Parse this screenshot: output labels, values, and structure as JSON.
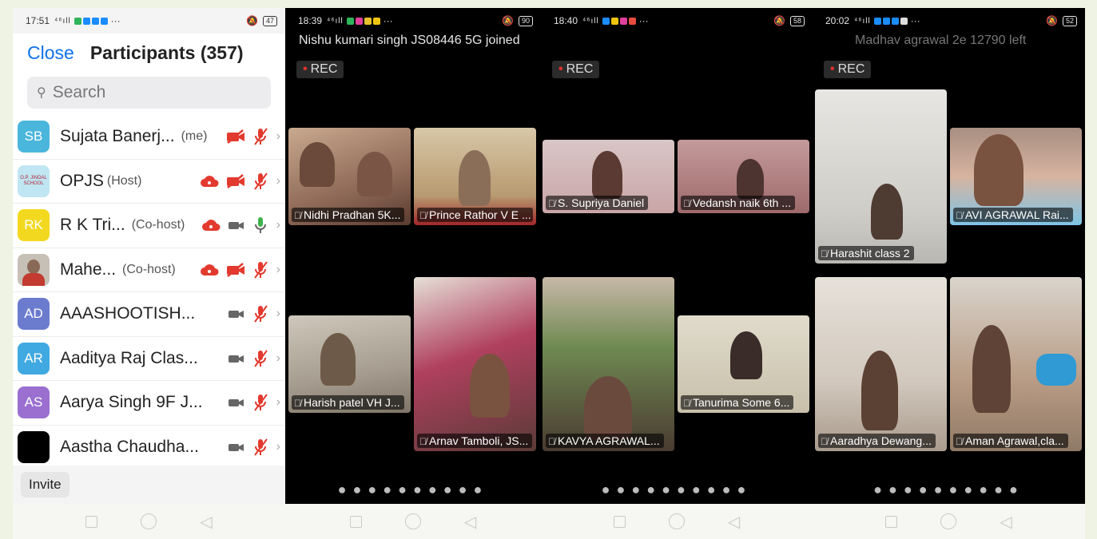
{
  "panel1": {
    "status": {
      "time": "17:51",
      "signal": "⁴⁶ıll",
      "battery": "47"
    },
    "close_label": "Close",
    "title": "Participants (357)",
    "search_placeholder": "Search",
    "participants": [
      {
        "initials": "SB",
        "avatar_color": "#4bb6dc",
        "name": "Sujata Banerj...",
        "role": "(me)"
      },
      {
        "initials": "O.P. JINDAL SCHOOL",
        "avatar_color": "#bfe6f2",
        "name": "OPJS",
        "role": "(Host)"
      },
      {
        "initials": "RK",
        "avatar_color": "#f2d91f",
        "name": "R K Tri...",
        "role": "(Co-host)"
      },
      {
        "initials": "",
        "avatar_color": "#8a6a57",
        "name": "Mahe...",
        "role": "(Co-host)"
      },
      {
        "initials": "AD",
        "avatar_color": "#6b7ccf",
        "name": "AAASHOOTISH...",
        "role": ""
      },
      {
        "initials": "AR",
        "avatar_color": "#41a9e1",
        "name": "Aaditya Raj Clas...",
        "role": ""
      },
      {
        "initials": "AS",
        "avatar_color": "#9a6fd0",
        "name": "Aarya Singh 9F J...",
        "role": ""
      },
      {
        "initials": "",
        "avatar_color": "#000000",
        "name": "Aastha Chaudha...",
        "role": ""
      }
    ],
    "invite_label": "Invite"
  },
  "panel2": {
    "status": {
      "time": "18:39",
      "signal": "⁴⁶ıll",
      "battery": "90"
    },
    "notice": "Nishu kumari singh JS08446 5G joined",
    "rec": "REC",
    "tiles": [
      "Nidhi Pradhan  5K...",
      "Prince Rathor V E ...",
      "Harish patel VH J...",
      "Arnav Tamboli, JS..."
    ]
  },
  "panel3": {
    "status": {
      "time": "18:40",
      "signal": "⁴⁶ıll",
      "battery": "58"
    },
    "rec": "REC",
    "tiles": [
      "S. Supriya Daniel",
      "Vedansh naik 6th ...",
      "KAVYA AGRAWAL...",
      "Tanurima Some 6..."
    ]
  },
  "panel4": {
    "status": {
      "time": "20:02",
      "signal": "⁴⁶ıll",
      "battery": "52"
    },
    "notice": "Madhav agrawal 2e 12790 left",
    "rec": "REC",
    "tiles": [
      "Harashit class 2",
      "AVI AGRAWAL Rai...",
      "Aaradhya Dewang...",
      "Aman Agrawal,cla..."
    ]
  },
  "colors": {
    "zoom_blue": "#0e71eb",
    "muted_red": "#e33a2f",
    "rec_red": "#e3312f"
  },
  "icons": [
    "search-icon",
    "video-off-icon",
    "mic-muted-icon",
    "mic-on-icon",
    "video-on-icon",
    "cloud-record-icon",
    "chevron-right-icon"
  ]
}
